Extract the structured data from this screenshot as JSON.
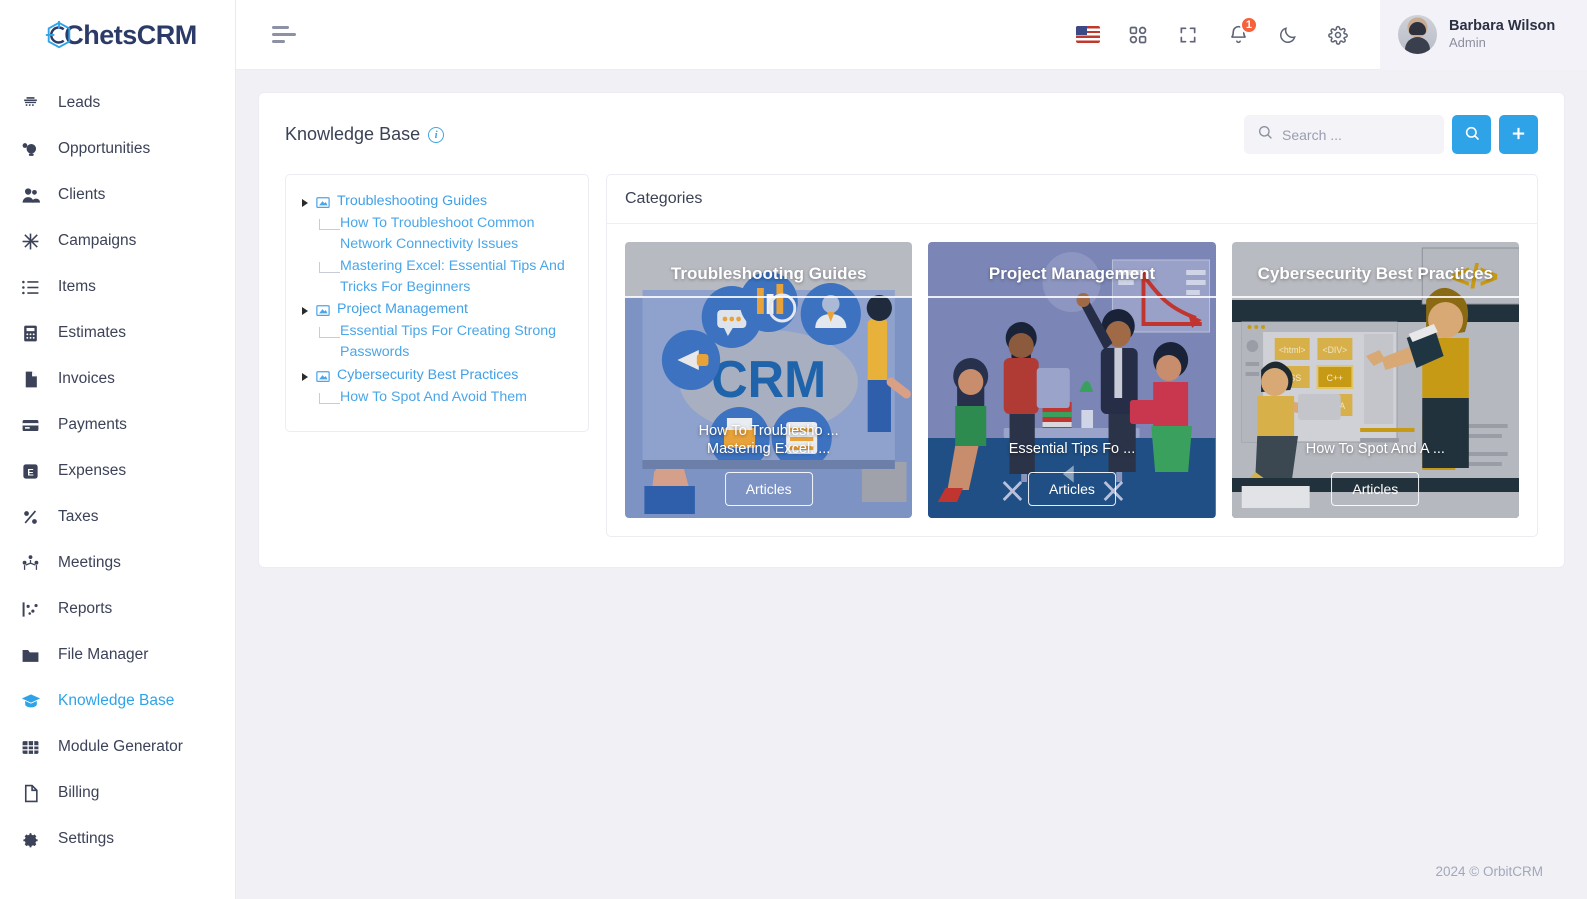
{
  "brand": {
    "name": "ChetsCRM",
    "logo_icon": "chets-logo-icon"
  },
  "sidebar": {
    "items": [
      {
        "label": "Leads",
        "icon": "telephone-icon",
        "active": false
      },
      {
        "label": "Opportunities",
        "icon": "lightbulb-icon",
        "active": false
      },
      {
        "label": "Clients",
        "icon": "user-group-icon",
        "active": false
      },
      {
        "label": "Campaigns",
        "icon": "asterisk-icon",
        "active": false
      },
      {
        "label": "Items",
        "icon": "list-icon",
        "active": false
      },
      {
        "label": "Estimates",
        "icon": "calculator-icon",
        "active": false
      },
      {
        "label": "Invoices",
        "icon": "document-icon",
        "active": false
      },
      {
        "label": "Payments",
        "icon": "credit-card-icon",
        "active": false
      },
      {
        "label": "Expenses",
        "icon": "expense-e-icon",
        "active": false
      },
      {
        "label": "Taxes",
        "icon": "percent-icon",
        "active": false
      },
      {
        "label": "Meetings",
        "icon": "people-meeting-icon",
        "active": false
      },
      {
        "label": "Reports",
        "icon": "chart-scatter-icon",
        "active": false
      },
      {
        "label": "File Manager",
        "icon": "folder-icon",
        "active": false
      },
      {
        "label": "Knowledge Base",
        "icon": "graduation-cap-icon",
        "active": true
      },
      {
        "label": "Module Generator",
        "icon": "grid-table-icon",
        "active": false
      },
      {
        "label": "Billing",
        "icon": "file-icon",
        "active": false
      },
      {
        "label": "Settings",
        "icon": "gear-icon",
        "active": false
      }
    ]
  },
  "topbar": {
    "menu_toggle_icon": "hamburger-icon",
    "icons": [
      {
        "name": "flag-us-icon"
      },
      {
        "name": "apps-grid-icon"
      },
      {
        "name": "fullscreen-icon"
      },
      {
        "name": "notification-bell-icon",
        "badge": "1"
      },
      {
        "name": "dark-mode-moon-icon"
      },
      {
        "name": "settings-gear-icon"
      }
    ],
    "notification_badge": "1",
    "user": {
      "name": "Barbara Wilson",
      "role": "Admin"
    }
  },
  "page": {
    "title": "Knowledge Base",
    "info_icon": "info-circle-icon",
    "search": {
      "placeholder": "Search ...",
      "value": ""
    },
    "search_button_icon": "search-icon",
    "add_button_icon": "plus-icon"
  },
  "tree": {
    "nodes": [
      {
        "label": "Troubleshooting Guides",
        "children": [
          "How To Troubleshoot Common Network Connectivity Issues",
          "Mastering Excel: Essential Tips And Tricks For Beginners"
        ]
      },
      {
        "label": "Project Management",
        "children": [
          "Essential Tips For Creating Strong Passwords"
        ]
      },
      {
        "label": "Cybersecurity Best Practices",
        "children": [
          "How To Spot And Avoid Them"
        ]
      }
    ]
  },
  "categories": {
    "heading": "Categories",
    "tiles": [
      {
        "title": "Troubleshooting Guides",
        "links": [
          "How To Troublesho ...",
          "Mastering Excel: ..."
        ],
        "button": "Articles"
      },
      {
        "title": "Project Management",
        "links": [
          "Essential Tips Fo ..."
        ],
        "button": "Articles"
      },
      {
        "title": "Cybersecurity Best Practices",
        "links": [
          "How To Spot And A ..."
        ],
        "button": "Articles"
      }
    ]
  },
  "footer": {
    "copyright": "2024 © OrbitCRM"
  },
  "colors": {
    "accent": "#2ea3e8",
    "link": "#4aa6e8",
    "badge": "#f4613b",
    "page_bg": "#f0f0f5",
    "brand_text": "#2b3a67"
  }
}
